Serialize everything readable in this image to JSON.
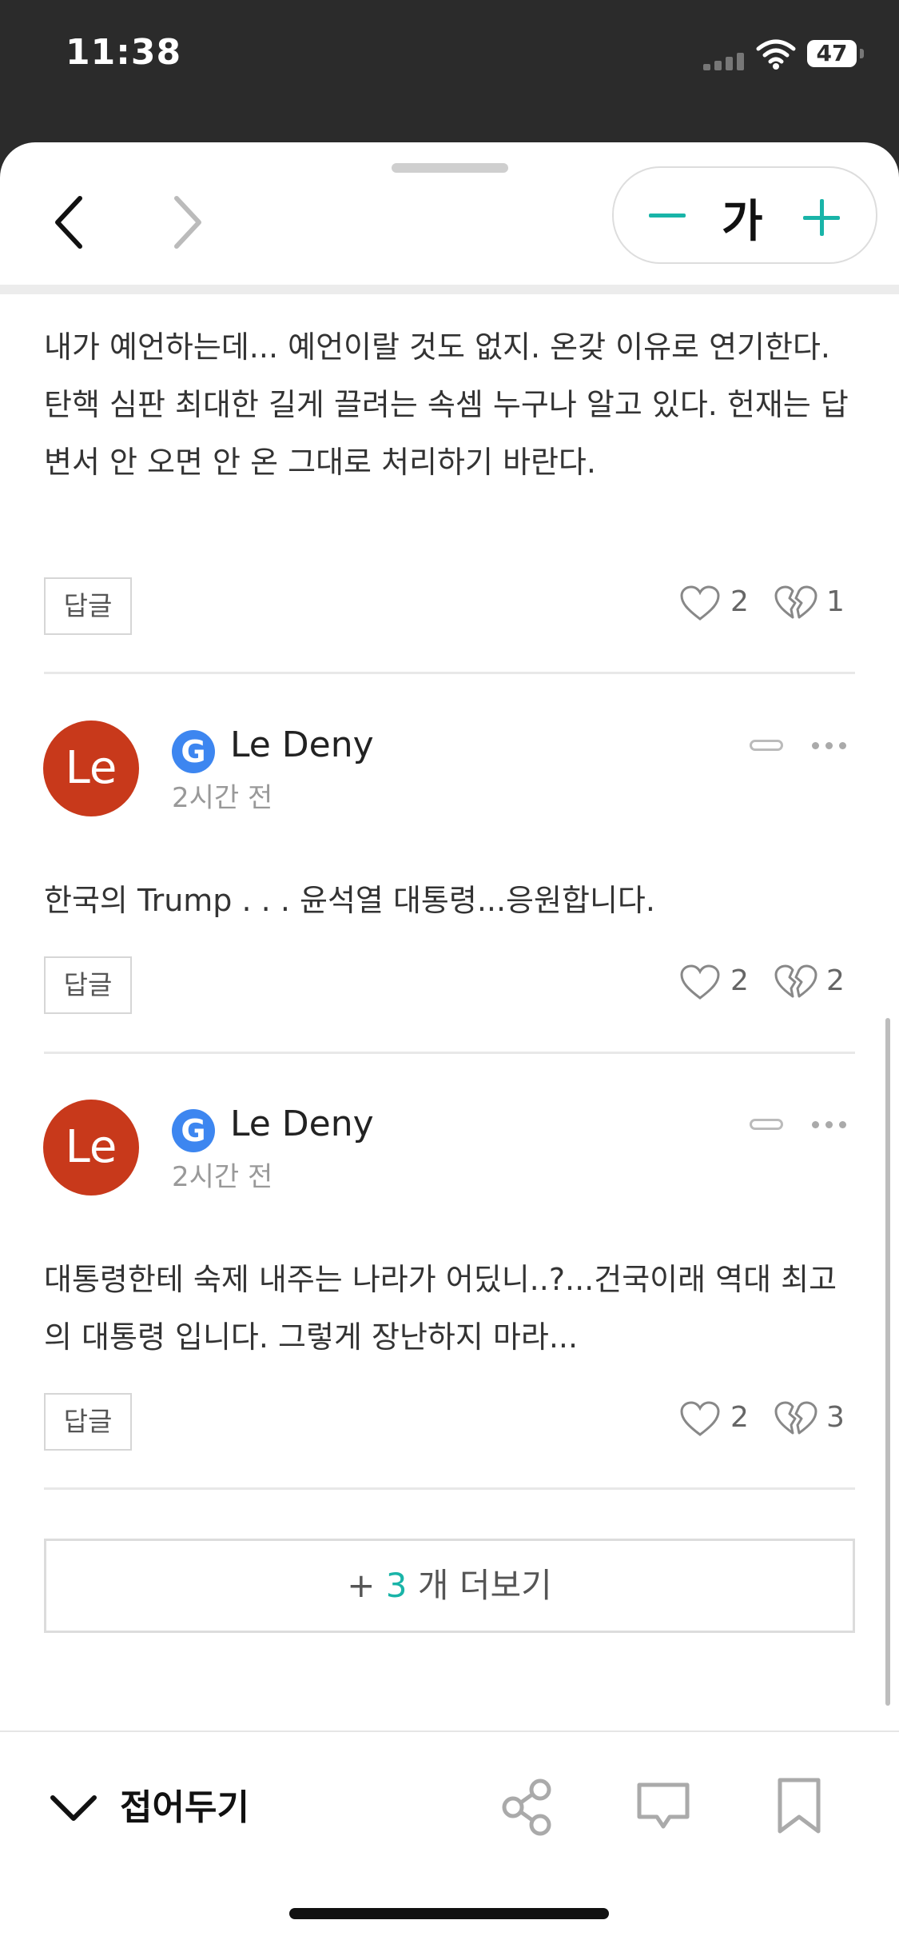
{
  "status": {
    "time": "11:38",
    "battery": "47"
  },
  "toolbar": {
    "font_label": "가"
  },
  "comments": [
    {
      "text": "내가 예언하는데... 예언이랄 것도 없지. 온갖 이유로 연기한다. 탄핵 심판 최대한 길게 끌려는 속셈 누구나 알고 있다. 헌재는 답변서 안 오면 안 온 그대로 처리하기 바란다.",
      "reply_label": "답글",
      "likes": "2",
      "dislikes": "1"
    },
    {
      "author": "Le Deny",
      "avatar_initials": "Le",
      "badge": "G",
      "time_ago": "2시간 전",
      "text": "한국의 Trump . . . 윤석열 대통령...응원합니다.",
      "reply_label": "답글",
      "likes": "2",
      "dislikes": "2"
    },
    {
      "author": "Le Deny",
      "avatar_initials": "Le",
      "badge": "G",
      "time_ago": "2시간 전",
      "text": "대통령한테 숙제 내주는 나라가 어딨니..?...건국이래 역대 최고의 대통령 입니다. 그렇게 장난하지 마라...",
      "reply_label": "답글",
      "likes": "2",
      "dislikes": "3"
    }
  ],
  "load_more": {
    "prefix": "+ ",
    "count": "3",
    "suffix": " 개 더보기"
  },
  "bottom": {
    "fold_label": "접어두기"
  },
  "colors": {
    "accent": "#19b4a8",
    "avatar": "#c8391b",
    "google_badge": "#3d86f0"
  }
}
